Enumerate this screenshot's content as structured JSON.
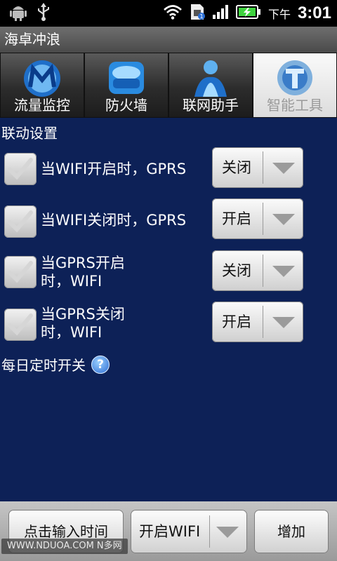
{
  "status": {
    "ampm": "下午",
    "time": "3:01",
    "icons": [
      "android-icon",
      "usb-icon",
      "wifi-icon",
      "sim-icon",
      "signal-icon",
      "battery-charging-icon"
    ]
  },
  "app": {
    "title": "海卓冲浪"
  },
  "tabs": [
    {
      "label": "流量监控",
      "icon": "traffic-monitor-icon",
      "active": false
    },
    {
      "label": "防火墙",
      "icon": "firewall-icon",
      "active": false
    },
    {
      "label": "联网助手",
      "icon": "network-assistant-icon",
      "active": false
    },
    {
      "label": "智能工具",
      "icon": "smart-tools-icon",
      "active": true
    }
  ],
  "section_title": "联动设置",
  "rules": [
    {
      "checked": true,
      "label": "当WIFI开启时，GPRS",
      "value": "关闭"
    },
    {
      "checked": true,
      "label": "当WIFI关闭时，GPRS",
      "value": "开启"
    },
    {
      "checked": true,
      "label_line1": "当GPRS开启",
      "label_line2": "时，WIFI",
      "value": "关闭"
    },
    {
      "checked": true,
      "label_line1": "当GPRS关闭",
      "label_line2": "时，WIFI",
      "value": "开启"
    }
  ],
  "daily": {
    "label": "每日定时开关",
    "help_icon": "?"
  },
  "bottom": {
    "input_time_button": "点击输入时间",
    "mode_spinner_value": "开启WIFI",
    "add_button": "增加"
  },
  "watermark": "WWW.NDUOA.COM N多网",
  "colors": {
    "background": "#0d2157",
    "status_bar": "#000000",
    "battery_accent": "#3fd33f"
  }
}
